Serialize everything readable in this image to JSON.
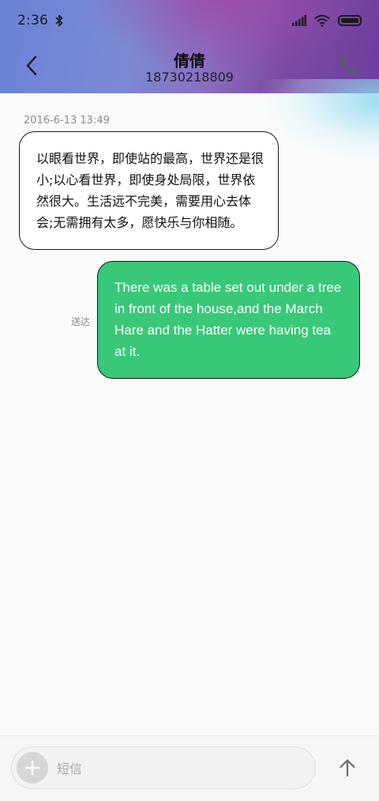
{
  "status_bar": {
    "time": "2:36",
    "battery_level": 1.0
  },
  "header": {
    "contact_name": "倩倩",
    "contact_number": "18730218809",
    "back_icon": "chevron-left-icon",
    "call_icon": "phone-icon"
  },
  "messages": [
    {
      "direction": "incoming",
      "timestamp": "2016-6-13 13:49",
      "lines": [
        "以眼看世界，即使站的最高，世界还是很",
        "小;以心看世界，即使身处局限，世界依",
        "然很大。生活远不完美，需要用心去体",
        "会;无需拥有太多，愿快乐与你相随。"
      ]
    },
    {
      "direction": "outgoing",
      "status": "送达",
      "lines": [
        "There was a table set out under a tree",
        "in front of the house,and the March",
        "Hare and the Hatter were having tea",
        "at it."
      ]
    }
  ],
  "composer": {
    "placeholder": "短信",
    "value": "",
    "add_icon": "plus-icon",
    "send_icon": "arrow-up-icon"
  },
  "colors": {
    "outgoing_bubble": "#38c878",
    "incoming_bubble": "#ffffff",
    "header_gradient_start": "#6a83d6",
    "header_gradient_end": "#6d3f9f"
  }
}
